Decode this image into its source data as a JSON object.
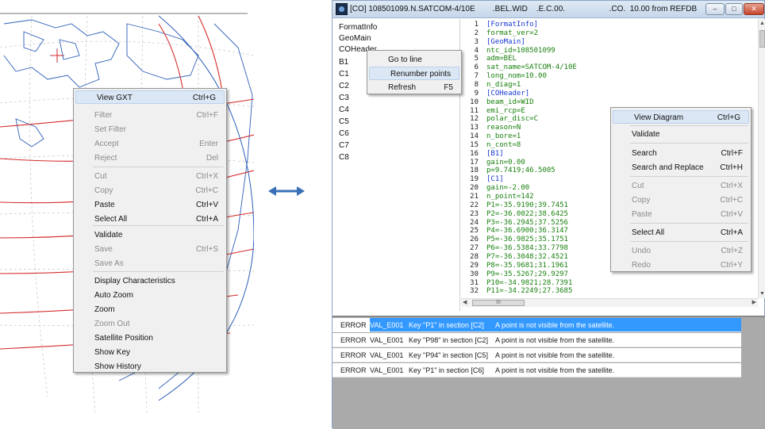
{
  "left_menu": {
    "items": [
      {
        "label": "View GXT",
        "shortcut": "Ctrl+G",
        "state": "highlighted"
      },
      {
        "label": "Filter",
        "shortcut": "Ctrl+F",
        "state": "disabled"
      },
      {
        "label": "Set Filter",
        "shortcut": "",
        "state": "disabled"
      },
      {
        "label": "Accept",
        "shortcut": "Enter",
        "state": "disabled"
      },
      {
        "label": "Reject",
        "shortcut": "Del",
        "state": "disabled"
      },
      {
        "label": "Cut",
        "shortcut": "Ctrl+X",
        "state": "disabled"
      },
      {
        "label": "Copy",
        "shortcut": "Ctrl+C",
        "state": "disabled"
      },
      {
        "label": "Paste",
        "shortcut": "Ctrl+V",
        "state": "enabled"
      },
      {
        "label": "Select All",
        "shortcut": "Ctrl+A",
        "state": "enabled"
      },
      {
        "label": "Validate",
        "shortcut": "",
        "state": "enabled"
      },
      {
        "label": "Save",
        "shortcut": "Ctrl+S",
        "state": "disabled"
      },
      {
        "label": "Save As",
        "shortcut": "",
        "state": "disabled"
      },
      {
        "label": "Display Characteristics",
        "shortcut": "",
        "state": "enabled"
      },
      {
        "label": "Auto Zoom",
        "shortcut": "",
        "state": "enabled"
      },
      {
        "label": "Zoom",
        "shortcut": "",
        "state": "enabled"
      },
      {
        "label": "Zoom Out",
        "shortcut": "",
        "state": "disabled"
      },
      {
        "label": "Satellite Position",
        "shortcut": "",
        "state": "enabled"
      },
      {
        "label": "Show Key",
        "shortcut": "",
        "state": "enabled"
      },
      {
        "label": "Show History",
        "shortcut": "",
        "state": "enabled"
      }
    ]
  },
  "arrow_icon": "double-arrow-icon",
  "window": {
    "title": "[CO] 108501099.N.SATCOM-4/10E        .BEL.WID    .E.C.00.                    .CO.  10.00 from REFDB",
    "controls": [
      "minimize",
      "maximize",
      "close"
    ],
    "tree": [
      "FormatInfo",
      "GeoMain",
      "COHeader",
      "B1",
      "C1",
      "C2",
      "C3",
      "C4",
      "C5",
      "C6",
      "C7",
      "C8"
    ],
    "tree_menu": [
      {
        "label": "Go to line",
        "shortcut": ""
      },
      {
        "label": "Renumber points",
        "shortcut": ""
      },
      {
        "label": "Refresh",
        "shortcut": "F5"
      }
    ],
    "lines": [
      {
        "n": "1",
        "t": "[FormatInfo]"
      },
      {
        "n": "2",
        "t": "format_ver=2"
      },
      {
        "n": "3",
        "t": "[GeoMain]"
      },
      {
        "n": "4",
        "t": "ntc_id=108501099"
      },
      {
        "n": "5",
        "t": "adm=BEL"
      },
      {
        "n": "6",
        "t": "sat_name=SATCOM-4/10E"
      },
      {
        "n": "7",
        "t": "long_nom=10.00"
      },
      {
        "n": "8",
        "t": "n_diag=1"
      },
      {
        "n": "9",
        "t": "[COHeader]"
      },
      {
        "n": "10",
        "t": "beam_id=WID"
      },
      {
        "n": "11",
        "t": "emi_rcp=E"
      },
      {
        "n": "12",
        "t": "polar_disc=C"
      },
      {
        "n": "13",
        "t": "reason=N"
      },
      {
        "n": "14",
        "t": "n_bore=1"
      },
      {
        "n": "15",
        "t": "n_cont=8"
      },
      {
        "n": "16",
        "t": "[B1]"
      },
      {
        "n": "17",
        "t": "gain=0.00"
      },
      {
        "n": "18",
        "t": "p=9.7419;46.5005"
      },
      {
        "n": "19",
        "t": "[C1]"
      },
      {
        "n": "20",
        "t": "gain=-2.00"
      },
      {
        "n": "21",
        "t": "n_point=142"
      },
      {
        "n": "22",
        "t": "P1=-35.9190;39.7451"
      },
      {
        "n": "23",
        "t": "P2=-36.0022;38.6425"
      },
      {
        "n": "24",
        "t": "P3=-36.2945;37.5256"
      },
      {
        "n": "25",
        "t": "P4=-36.6900;36.3147"
      },
      {
        "n": "26",
        "t": "P5=-36.9825;35.1751"
      },
      {
        "n": "27",
        "t": "P6=-36.5384;33.7798"
      },
      {
        "n": "28",
        "t": "P7=-36.3048;32.4521"
      },
      {
        "n": "29",
        "t": "P8=-35.9681;31.1961"
      },
      {
        "n": "30",
        "t": "P9=-35.5267;29.9297"
      },
      {
        "n": "31",
        "t": "P10=-34.9821;28.7391"
      },
      {
        "n": "32",
        "t": "P11=-34.2249;27.3685"
      }
    ],
    "editor_menu": [
      {
        "label": "View Diagram",
        "shortcut": "Ctrl+G",
        "state": "highlighted"
      },
      {
        "label": "Validate",
        "shortcut": "",
        "state": "enabled"
      },
      {
        "label": "Search",
        "shortcut": "Ctrl+F",
        "state": "enabled"
      },
      {
        "label": "Search and Replace",
        "shortcut": "Ctrl+H",
        "state": "enabled"
      },
      {
        "label": "Cut",
        "shortcut": "Ctrl+X",
        "state": "disabled"
      },
      {
        "label": "Copy",
        "shortcut": "Ctrl+C",
        "state": "disabled"
      },
      {
        "label": "Paste",
        "shortcut": "Ctrl+V",
        "state": "disabled"
      },
      {
        "label": "Select All",
        "shortcut": "Ctrl+A",
        "state": "enabled"
      },
      {
        "label": "Undo",
        "shortcut": "Ctrl+Z",
        "state": "disabled"
      },
      {
        "label": "Redo",
        "shortcut": "Ctrl+Y",
        "state": "disabled"
      }
    ],
    "hscroll_grip": "III",
    "errors": [
      {
        "type": "ERROR",
        "code": "VAL_E001",
        "where": "Key \"P1\" in section [C2]",
        "msg": "A point is not visible from the satellite."
      },
      {
        "type": "ERROR",
        "code": "VAL_E001",
        "where": "Key \"P98\" in section [C2]",
        "msg": "A point is not visible from the satellite."
      },
      {
        "type": "ERROR",
        "code": "VAL_E001",
        "where": "Key \"P94\" in section [C5]",
        "msg": "A point is not visible from the satellite."
      },
      {
        "type": "ERROR",
        "code": "VAL_E001",
        "where": "Key \"P1\" in section [C6]",
        "msg": "A point is not visible from the satellite."
      }
    ]
  },
  "colors": {
    "contour": "#d42a2a",
    "coast": "#2c5fb8",
    "selection": "#3399ff",
    "code_section": "#1a3ad0",
    "code_value": "#19810f"
  }
}
